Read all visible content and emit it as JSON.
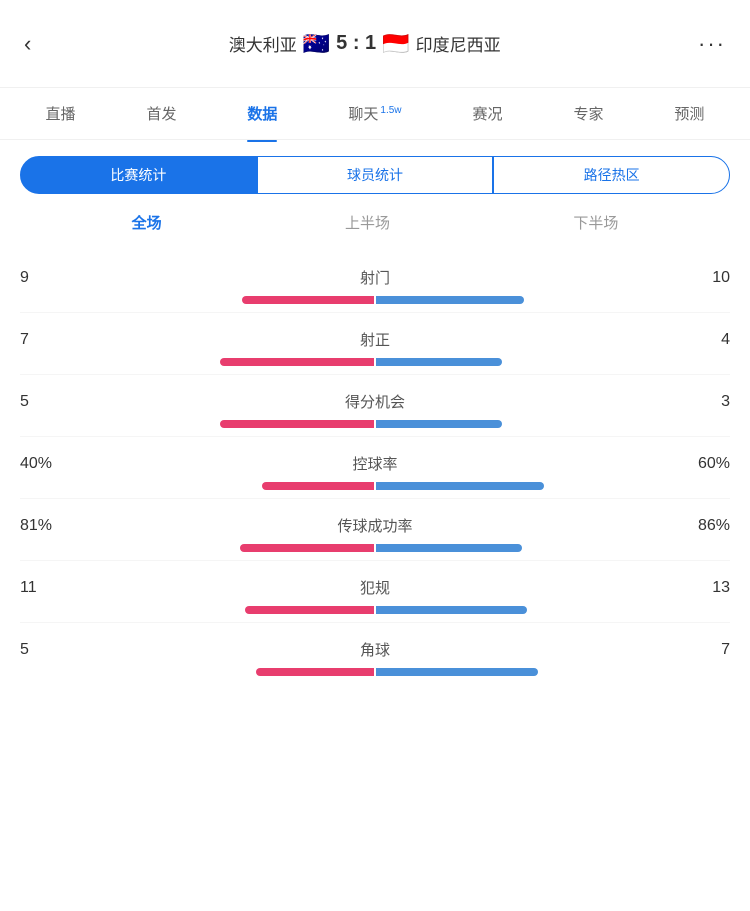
{
  "header": {
    "back_icon": "←",
    "team_left": "澳大利亚",
    "flag_left": "🇦🇺",
    "score": "5 : 1",
    "flag_right": "🇮🇩",
    "team_right": "印度尼西亚",
    "more_icon": "···"
  },
  "nav": {
    "tabs": [
      {
        "label": "直播",
        "active": false,
        "badge": ""
      },
      {
        "label": "首发",
        "active": false,
        "badge": ""
      },
      {
        "label": "数据",
        "active": true,
        "badge": ""
      },
      {
        "label": "聊天",
        "active": false,
        "badge": "1.5w"
      },
      {
        "label": "赛况",
        "active": false,
        "badge": ""
      },
      {
        "label": "专家",
        "active": false,
        "badge": ""
      },
      {
        "label": "预测",
        "active": false,
        "badge": ""
      }
    ]
  },
  "sub_tabs": [
    {
      "label": "比赛统计",
      "active": true
    },
    {
      "label": "球员统计",
      "active": false
    },
    {
      "label": "路径热区",
      "active": false
    }
  ],
  "period_tabs": [
    {
      "label": "全场",
      "active": true
    },
    {
      "label": "上半场",
      "active": false
    },
    {
      "label": "下半场",
      "active": false
    }
  ],
  "stats": [
    {
      "label": "射门",
      "left_val": "9",
      "right_val": "10",
      "left_pct": 47,
      "right_pct": 53
    },
    {
      "label": "射正",
      "left_val": "7",
      "right_val": "4",
      "left_pct": 55,
      "right_pct": 45
    },
    {
      "label": "得分机会",
      "left_val": "5",
      "right_val": "3",
      "left_pct": 55,
      "right_pct": 45
    },
    {
      "label": "控球率",
      "left_val": "40%",
      "right_val": "60%",
      "left_pct": 40,
      "right_pct": 60
    },
    {
      "label": "传球成功率",
      "left_val": "81%",
      "right_val": "86%",
      "left_pct": 48,
      "right_pct": 52
    },
    {
      "label": "犯规",
      "left_val": "11",
      "right_val": "13",
      "left_pct": 46,
      "right_pct": 54
    },
    {
      "label": "角球",
      "left_val": "5",
      "right_val": "7",
      "left_pct": 42,
      "right_pct": 58
    }
  ],
  "colors": {
    "accent": "#1a73e8",
    "left_bar": "#e83d6e",
    "right_bar": "#4a90d9"
  }
}
